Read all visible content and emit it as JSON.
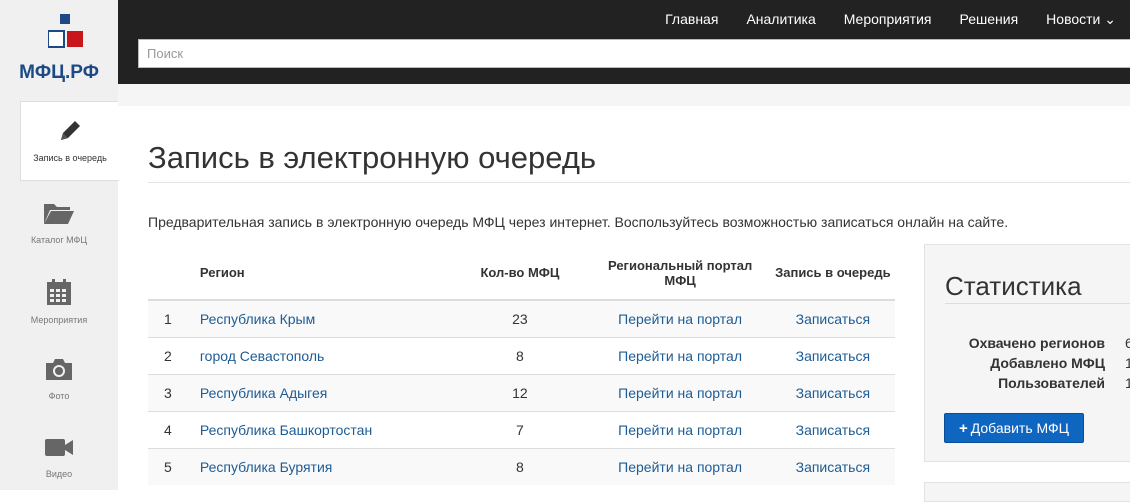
{
  "logo": {
    "text": "МФЦ.РФ",
    "colors": [
      "#1d4a86",
      "#c8161d",
      "#3a5f95"
    ]
  },
  "sidebar": {
    "items": [
      {
        "label": "Запись в очередь",
        "icon": "pencil-icon",
        "active": true
      },
      {
        "label": "Каталог МФЦ",
        "icon": "folder-icon"
      },
      {
        "label": "Мероприятия",
        "icon": "calendar-icon"
      },
      {
        "label": "Фото",
        "icon": "camera-icon"
      },
      {
        "label": "Видео",
        "icon": "video-camera-icon"
      }
    ]
  },
  "nav": {
    "items": [
      "Главная",
      "Аналитика",
      "Мероприятия",
      "Решения",
      "Новости"
    ]
  },
  "search": {
    "placeholder": "Поиск",
    "value": ""
  },
  "main": {
    "title": "Запись в электронную очередь",
    "intro": "Предварительная запись в электронную очередь МФЦ через интернет. Воспользуйтесь возможностью записаться онлайн на сайте."
  },
  "table": {
    "headers": {
      "num": "",
      "region": "Регион",
      "count": "Кол-во МФЦ",
      "portal": "Региональный портал МФЦ",
      "signup": "Запись в очередь"
    },
    "rows": [
      {
        "num": "1",
        "region": "Республика Крым",
        "count": "23",
        "portal": "Перейти на портал",
        "signup": "Записаться"
      },
      {
        "num": "2",
        "region": "город Севастополь",
        "count": "8",
        "portal": "Перейти на портал",
        "signup": "Записаться"
      },
      {
        "num": "3",
        "region": "Республика Адыгея",
        "count": "12",
        "portal": "Перейти на портал",
        "signup": "Записаться"
      },
      {
        "num": "4",
        "region": "Республика Башкортостан",
        "count": "7",
        "portal": "Перейти на портал",
        "signup": "Записаться"
      },
      {
        "num": "5",
        "region": "Республика Бурятия",
        "count": "8",
        "portal": "Перейти на портал",
        "signup": "Записаться"
      }
    ]
  },
  "stats": {
    "title": "Статистика",
    "rows": [
      {
        "label": "Охвачено регионов",
        "value": "6"
      },
      {
        "label": "Добавлено МФЦ",
        "value": "1"
      },
      {
        "label": "Пользователей",
        "value": "1"
      }
    ],
    "add_button": "Добавить МФЦ",
    "accent": "#0f66c0"
  }
}
